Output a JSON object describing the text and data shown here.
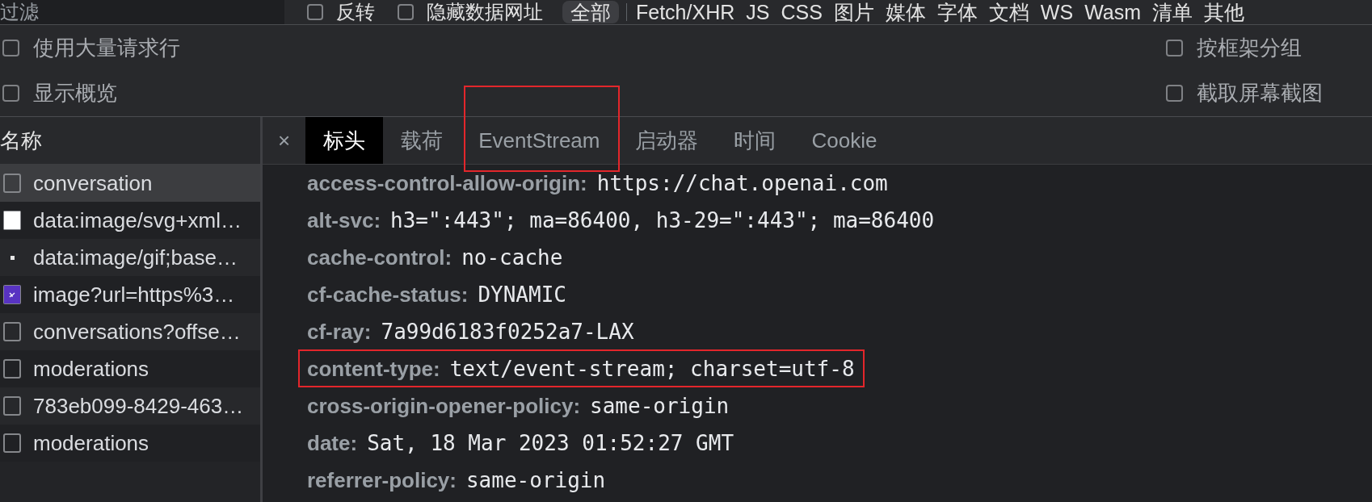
{
  "toolbar": {
    "filter": {
      "placeholder": "过滤"
    },
    "checkboxes": [
      {
        "label": "反转",
        "checked": false
      },
      {
        "label": "隐藏数据网址",
        "checked": false
      }
    ],
    "type_filters": [
      {
        "label": "全部",
        "selected": true
      },
      {
        "label": "Fetch/XHR",
        "selected": false
      },
      {
        "label": "JS",
        "selected": false
      },
      {
        "label": "CSS",
        "selected": false
      },
      {
        "label": "图片",
        "selected": false
      },
      {
        "label": "媒体",
        "selected": false
      },
      {
        "label": "字体",
        "selected": false
      },
      {
        "label": "文档",
        "selected": false
      },
      {
        "label": "WS",
        "selected": false
      },
      {
        "label": "Wasm",
        "selected": false
      },
      {
        "label": "清单",
        "selected": false
      },
      {
        "label": "其他",
        "selected": false
      }
    ]
  },
  "options": {
    "left": [
      {
        "label": "使用大量请求行",
        "checked": false
      },
      {
        "label": "显示概览",
        "checked": false
      }
    ],
    "right": [
      {
        "label": "按框架分组",
        "checked": false
      },
      {
        "label": "截取屏幕截图",
        "checked": false
      }
    ]
  },
  "request_list": {
    "header": "名称",
    "rows": [
      {
        "name": "conversation",
        "kind": "document",
        "selected": true
      },
      {
        "name": "data:image/svg+xml…",
        "kind": "blank_image",
        "selected": false
      },
      {
        "name": "data:image/gif;base…",
        "kind": "tiny_image",
        "selected": false
      },
      {
        "name": "image?url=https%3…",
        "kind": "image",
        "selected": false
      },
      {
        "name": "conversations?offse…",
        "kind": "document",
        "selected": false
      },
      {
        "name": "moderations",
        "kind": "document",
        "selected": false
      },
      {
        "name": "783eb099-8429-463…",
        "kind": "document",
        "selected": false
      },
      {
        "name": "moderations",
        "kind": "document",
        "selected": false
      }
    ]
  },
  "detail": {
    "close": "×",
    "tabs": [
      {
        "label": "标头",
        "selected": true,
        "highlighted": false
      },
      {
        "label": "载荷",
        "selected": false,
        "highlighted": false
      },
      {
        "label": "EventStream",
        "selected": false,
        "highlighted": true
      },
      {
        "label": "启动器",
        "selected": false,
        "highlighted": false
      },
      {
        "label": "时间",
        "selected": false,
        "highlighted": false
      },
      {
        "label": "Cookie",
        "selected": false,
        "highlighted": false
      }
    ],
    "headers": [
      {
        "key": "access-control-allow-origin:",
        "value": "https://chat.openai.com",
        "highlighted": false
      },
      {
        "key": "alt-svc:",
        "value": "h3=\":443\"; ma=86400, h3-29=\":443\"; ma=86400",
        "highlighted": false
      },
      {
        "key": "cache-control:",
        "value": "no-cache",
        "highlighted": false
      },
      {
        "key": "cf-cache-status:",
        "value": "DYNAMIC",
        "highlighted": false
      },
      {
        "key": "cf-ray:",
        "value": "7a99d6183f0252a7-LAX",
        "highlighted": false
      },
      {
        "key": "content-type:",
        "value": "text/event-stream; charset=utf-8",
        "highlighted": true
      },
      {
        "key": "cross-origin-opener-policy:",
        "value": "same-origin",
        "highlighted": false
      },
      {
        "key": "date:",
        "value": "Sat, 18 Mar 2023 01:52:27 GMT",
        "highlighted": false
      },
      {
        "key": "referrer-policy:",
        "value": "same-origin",
        "highlighted": false
      }
    ]
  }
}
